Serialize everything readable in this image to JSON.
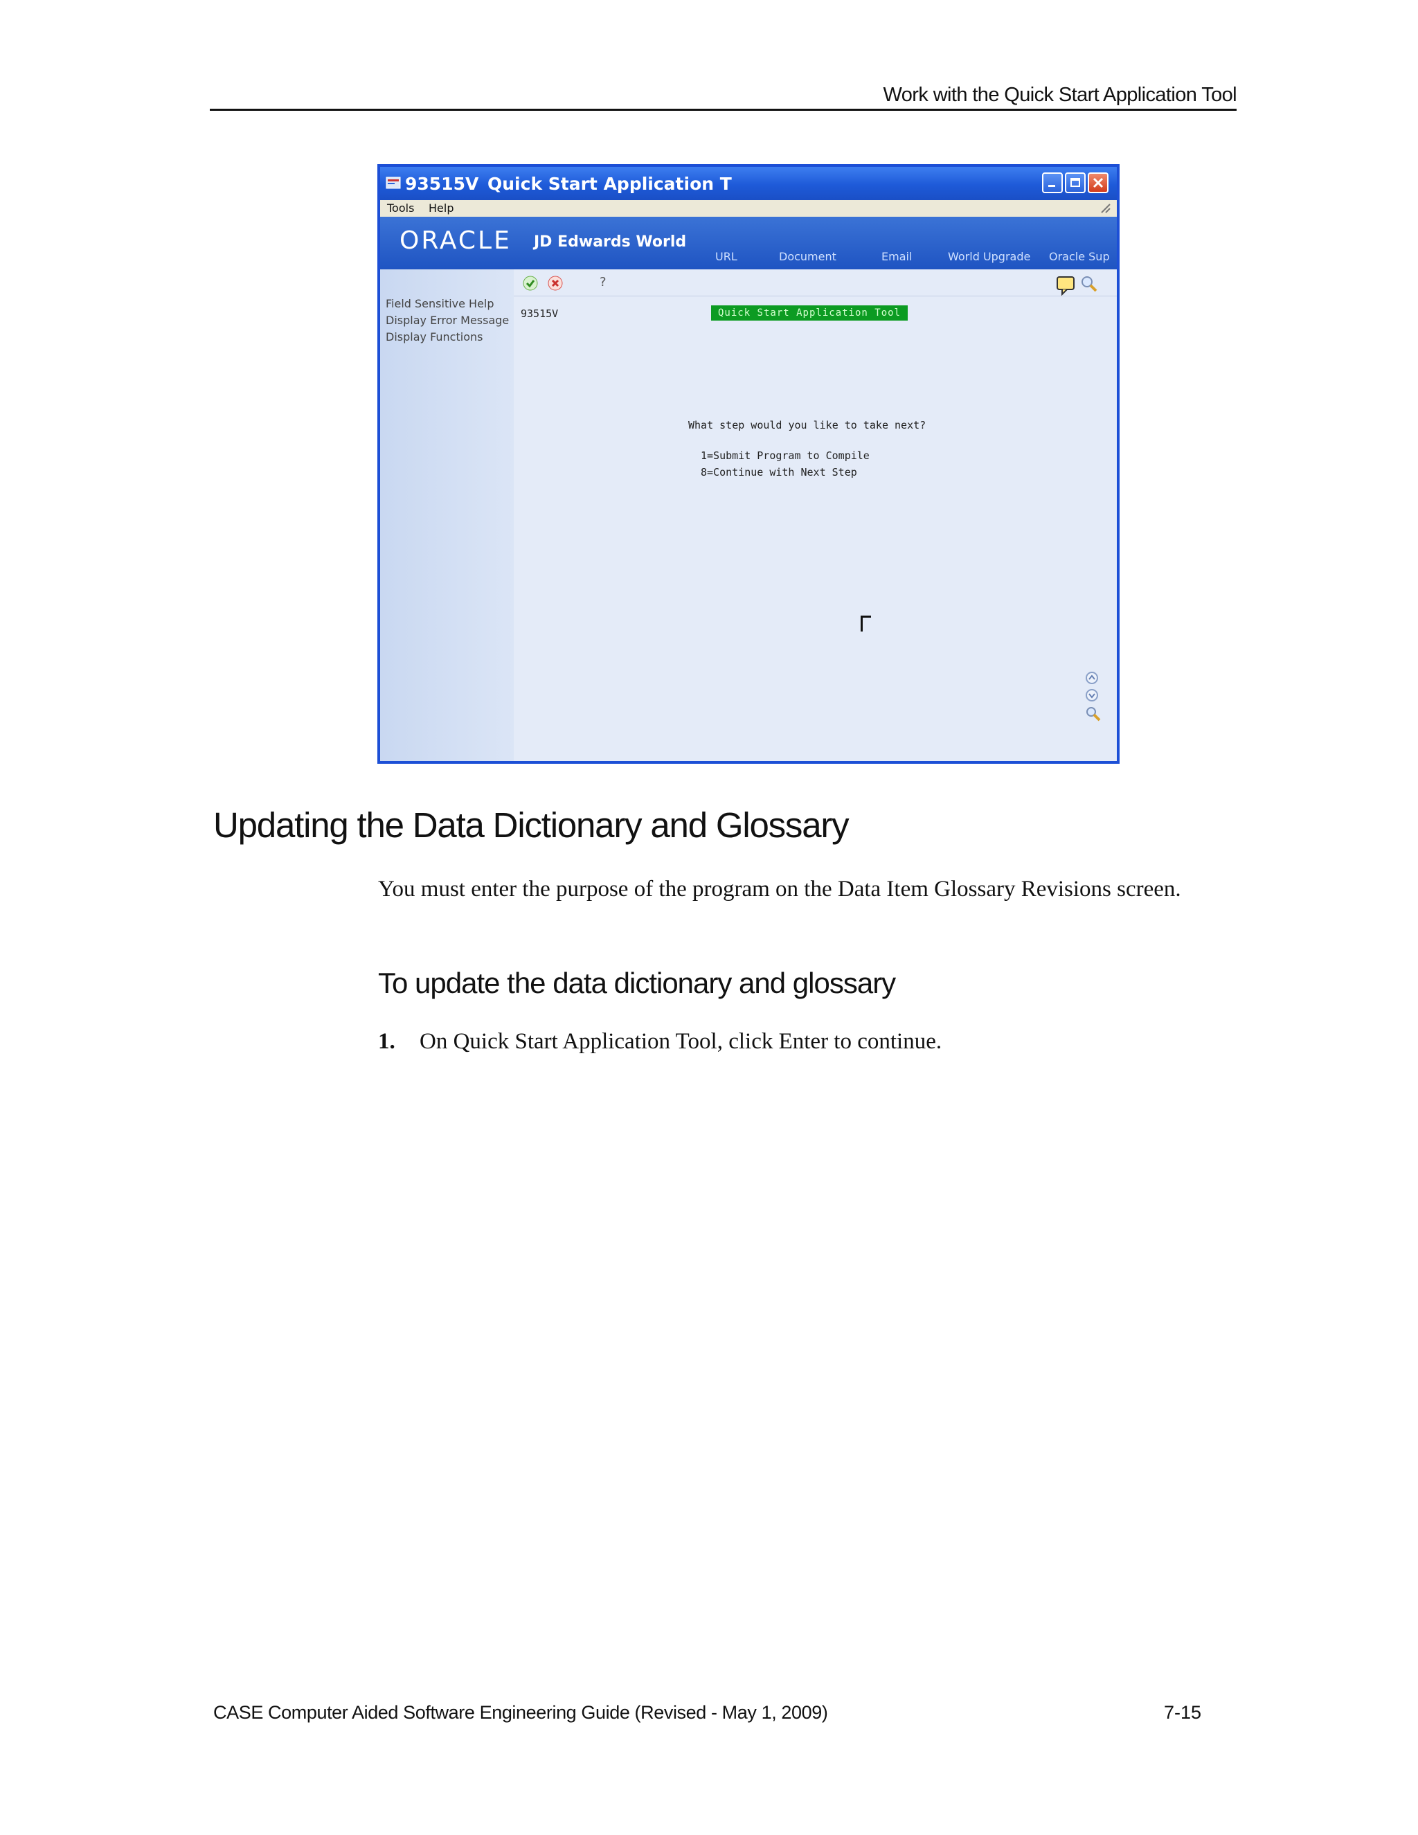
{
  "running_header": "Work with the Quick Start Application Tool",
  "screenshot": {
    "window_code": "93515V",
    "window_title": "Quick Start Application T",
    "menu": [
      "Tools",
      "Help"
    ],
    "brand_oracle": "ORACLE",
    "brand_product": "JD Edwards World",
    "nav_links": [
      "URL",
      "Document",
      "Email",
      "World Upgrade",
      "Oracle Sup"
    ],
    "side_links": [
      "Field Sensitive Help",
      "Display Error Message",
      "Display Functions"
    ],
    "toolbar_question": "?",
    "program_id": "93515V",
    "screen_title_badge": "Quick Start Application Tool",
    "prompt": "What step would you like to take next?",
    "options": [
      "1=Submit Program to Compile",
      "8=Continue with Next Step"
    ],
    "icons": [
      "check-icon",
      "cancel-icon",
      "help-icon",
      "chat-icon",
      "search-icon",
      "scroll-up-icon",
      "scroll-down-icon",
      "zoom-icon"
    ],
    "colors": {
      "titlebar": "#1e5ad8",
      "badge": "#0c9b22",
      "close": "#d23c1c"
    }
  },
  "section_heading": "Updating the Data Dictionary and Glossary",
  "intro_paragraph": "You must enter the purpose of the program on the Data Item Glossary Revisions screen.",
  "procedure_heading": "To update the data dictionary and glossary",
  "steps": [
    {
      "num": "1.",
      "text": "On Quick Start Application Tool, click Enter to continue."
    }
  ],
  "footer": {
    "title": "CASE Computer Aided Software Engineering Guide (Revised - May 1, 2009)",
    "page": "7-15"
  }
}
